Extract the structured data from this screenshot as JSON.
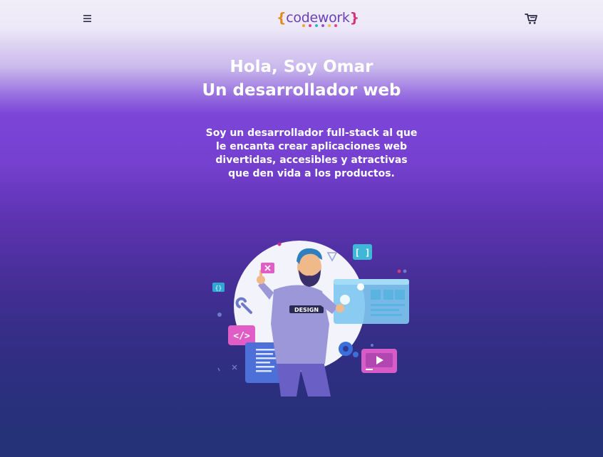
{
  "header": {
    "menu_icon": "hamburger-menu-icon",
    "cart_icon": "shopping-cart-icon",
    "logo": {
      "open_brace": "{",
      "name": "codework",
      "close_brace": "}",
      "dot_colors": [
        "#f2a23a",
        "#e0418b",
        "#2fb5c9",
        "#8c4fd6",
        "#f2c14e",
        "#e0418b"
      ]
    }
  },
  "hero": {
    "title_line1": "Hola, Soy Omar",
    "title_line2": "Un desarrollador web",
    "description": "Soy un desarrollador full-stack al que le encanta crear aplicaciones web divertidas, accesibles y atractivas que den vida a los productos.",
    "illustration": {
      "badge_text": "DESIGN",
      "code_tag": "</>",
      "bracket_tag": "[ ]",
      "close_icon": "x-icon"
    }
  },
  "colors": {
    "gradient_top": "#f1eef9",
    "gradient_mid": "#7c45d8",
    "gradient_bottom": "#263078",
    "text": "#ffffff"
  }
}
